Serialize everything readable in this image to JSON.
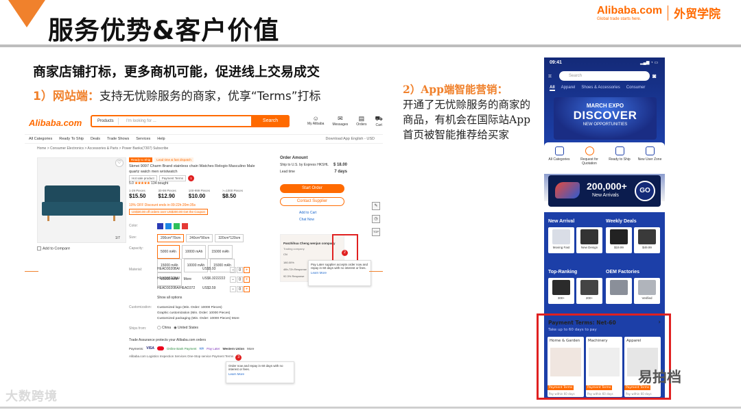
{
  "slide": {
    "title": "服务优势&客户价值",
    "logo_brand": "Alibaba.com",
    "logo_slogan": "Global trade starts here.",
    "logo_academy": "外贸学院",
    "heading": "商家店铺打标，更多商机可能，促进线上交易成交",
    "point1_label": "1）网站端：",
    "point1_text": "支持无忧赊服务的商家，优享“Terms”打标",
    "point2_label": "2）App端智能营销：",
    "point2_text": "开通了无忧赊服务的商家的商品，有机会在国际站App首页被智能推荐给买家",
    "watermark_left": "大数跨境",
    "watermark_right": "易拍档"
  },
  "web": {
    "logo": "Alibaba.com",
    "search_category": "Products",
    "search_placeholder": "I'm looking for ...",
    "search_button": "Search",
    "header_icons": [
      "My Alibaba",
      "Messages",
      "Orders",
      "Cart"
    ],
    "nav": [
      "All Categories",
      "Ready To Ship",
      "Deals",
      "Trade Shows",
      "Services",
      "Help"
    ],
    "nav_right": "Download App   English - USD",
    "breadcrumb": "Home > Consumer Electronics > Accessories & Parts > Power Banks(7307)  Subscribe",
    "ready_badges": [
      "Ready to Ship",
      "Lead time & fast dispatch"
    ],
    "product_title": "Skmei 9097 Charm Brand stainless chain Watches Relogio Masculino Male quartz watch men wristwatch",
    "tags": [
      "Hot sale product",
      "Payment Terms"
    ],
    "rating": "5.0",
    "stars": "★★★★★",
    "bought": "134 bought",
    "prices": [
      {
        "qty": "1-29 Pieces",
        "price": "$15.50"
      },
      {
        "qty": "30-99 Pieces",
        "price": "$12.90"
      },
      {
        "qty": "100-999 Pieces",
        "price": "$10.00"
      },
      {
        "qty": ">=1000 Pieces",
        "price": "$8.50"
      }
    ],
    "discount": "10% OFF  Discount ends in  09:22h:20m:35s",
    "coupon": "US$30.00 off orders over US$300.00  Get the Coupon",
    "photo_count": "1/7",
    "add_compare": "Add to Compare",
    "labels": {
      "color": "Color:",
      "size": "Size:",
      "capacity": "Capacity:",
      "material": "Material:",
      "customization": "Customization:",
      "ships_from": "Ships from:"
    },
    "sizes": [
      "200cm*70cm",
      "240cm*90cm",
      "320cm*120cm"
    ],
    "capacities": [
      "5000 mAh",
      "10000 mAh",
      "15000 mAh",
      "15000 mAh",
      "10000 mAh",
      "15000 mAh",
      "15000 mAh",
      "More"
    ],
    "materials": [
      {
        "name": "HEAD3020BA/",
        "price": "US$5.93",
        "qty": "0"
      },
      {
        "name": "HEAD3020BA/",
        "price": "US$6.3222222",
        "qty": "0"
      },
      {
        "name": "HEAD3020BA/HEAD372",
        "price": "US$3.59",
        "qty": "0"
      }
    ],
    "show_all": "Show all options",
    "customizations": [
      "Customized logo (Min. Order: 10000 Pieces)",
      "Graphic customization (Min. Order: 10000 Pieces)",
      "Customized packaging (Min. Order: 10000 Pieces)   More"
    ],
    "ships": [
      "China",
      "United States"
    ],
    "trade_assurance": "Trade Assurance protects your Alibaba.com orders",
    "payments_label": "Payments:",
    "payments": [
      "VISA",
      "Online Bank Payment",
      "T/T",
      "Pay Later",
      "Western Union",
      "More"
    ],
    "services": "Alibaba.com Logistics   Inspection Services   One-Stop service   Payment Terms",
    "order": {
      "title": "Order Amount",
      "ship_label": "Ship to U.S. by Express HKSHL",
      "ship_price": "$ 18.00",
      "lead_label": "Lead time",
      "lead_value": "7 days",
      "start": "Start Order",
      "contact": "Contact Supplier",
      "add_cart": "Add to Cart",
      "chat": "Chat Now"
    },
    "supplier": {
      "name": "Panzhihua Cheng wenjun company",
      "type": "Trading company",
      "country": "CN",
      "m1": "180.00%",
      "m2": "48h-72h  Response",
      "m3": "92.3%  Response"
    },
    "tooltip": "Pay Later supplier accepts order now and repay in 60 days with no interest or fees.",
    "tooltip2": "Order now and repay in 60 days with no interest or fees.",
    "learn_more": "Learn More",
    "badge_num1": "1",
    "badge_num2": "2",
    "badge_num3": "3"
  },
  "app": {
    "time": "09:41",
    "status": "▂▄▆ ◔ ▭",
    "search_placeholder": "Search",
    "tabs": [
      "All",
      "Apparel",
      "Shoes & Accessories",
      "Consumer"
    ],
    "banner_l1": "MARCH EXPO",
    "banner_l2": "DISCOVER",
    "banner_l3": "NEW OPPORTUNITIES",
    "categories": [
      "All Categories",
      "Request for Quotation",
      "Ready to Ship",
      "New User Zone"
    ],
    "new_arrivals_count": "200,000+",
    "new_arrivals_label": "New Arrivals",
    "go": "GO",
    "sec1_title": "New Arrival",
    "sec2_title": "Weekly Deals",
    "sec1_items": [
      "Moving Fast",
      "New Design"
    ],
    "sec2_items": [
      "$19.99",
      "$49.99"
    ],
    "sec3_title": "Top-Ranking",
    "sec4_title": "OEM Factories",
    "sec3_items": [
      "300+",
      "200+"
    ],
    "sec4_items": [
      "",
      "Verified"
    ],
    "pay_title": "Payment Terms: Net-60",
    "pay_sub": "Take up to 60 days to pay",
    "pay_cards": [
      {
        "name": "Home & Garden",
        "tag": "Payment Terms",
        "days": "Pay within 60 days"
      },
      {
        "name": "Machinery",
        "tag": "Payment Terms",
        "days": "Pay within 60 days"
      },
      {
        "name": "Apparel",
        "tag": "Payment Terms",
        "days": "Pay within 60 days"
      }
    ]
  }
}
